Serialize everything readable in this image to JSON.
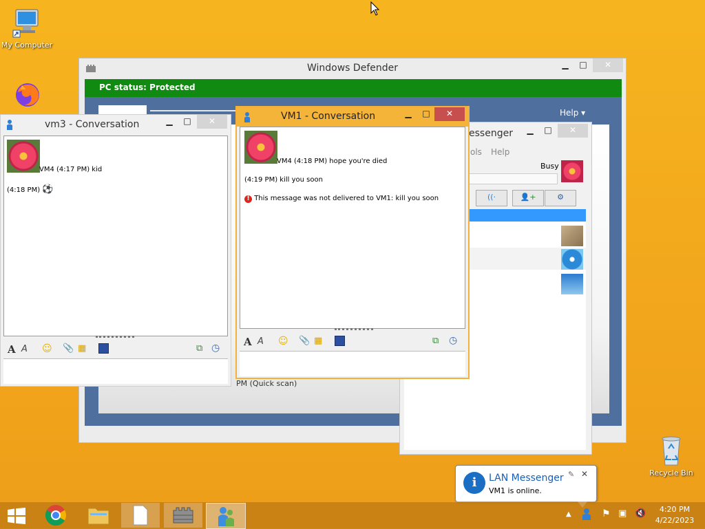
{
  "desktop": {
    "icons": [
      {
        "label": "My Computer",
        "icon": "computer-icon"
      },
      {
        "label": "Recycle Bin",
        "icon": "recycle-bin-icon"
      }
    ]
  },
  "defender": {
    "title": "Windows Defender",
    "status": "PC status: Protected",
    "help": "Help",
    "scan_text": "PM (Quick scan)",
    "status_color": "#108c10"
  },
  "messenger": {
    "title": "LAN Messenger",
    "title_visible": "essenger",
    "menu": [
      "ols",
      "Help"
    ],
    "status": "Busy",
    "accent": "#3399ff"
  },
  "vm3": {
    "title": "vm3 - Conversation",
    "messages": [
      {
        "text": "VM4 (4:17 PM) kid"
      },
      {
        "text": "(4:18 PM)"
      }
    ]
  },
  "vm1": {
    "title": "VM1 - Conversation",
    "messages": [
      {
        "text": "VM4 (4:18 PM) hope you're died"
      },
      {
        "text": "(4:19 PM) kill you soon"
      },
      {
        "text": "This message was not delivered to VM1: kill you soon"
      }
    ]
  },
  "notification": {
    "title": "LAN Messenger",
    "body": "VM1 is online."
  },
  "taskbar": {
    "time": "4:20 PM",
    "date": "4/22/2023"
  }
}
